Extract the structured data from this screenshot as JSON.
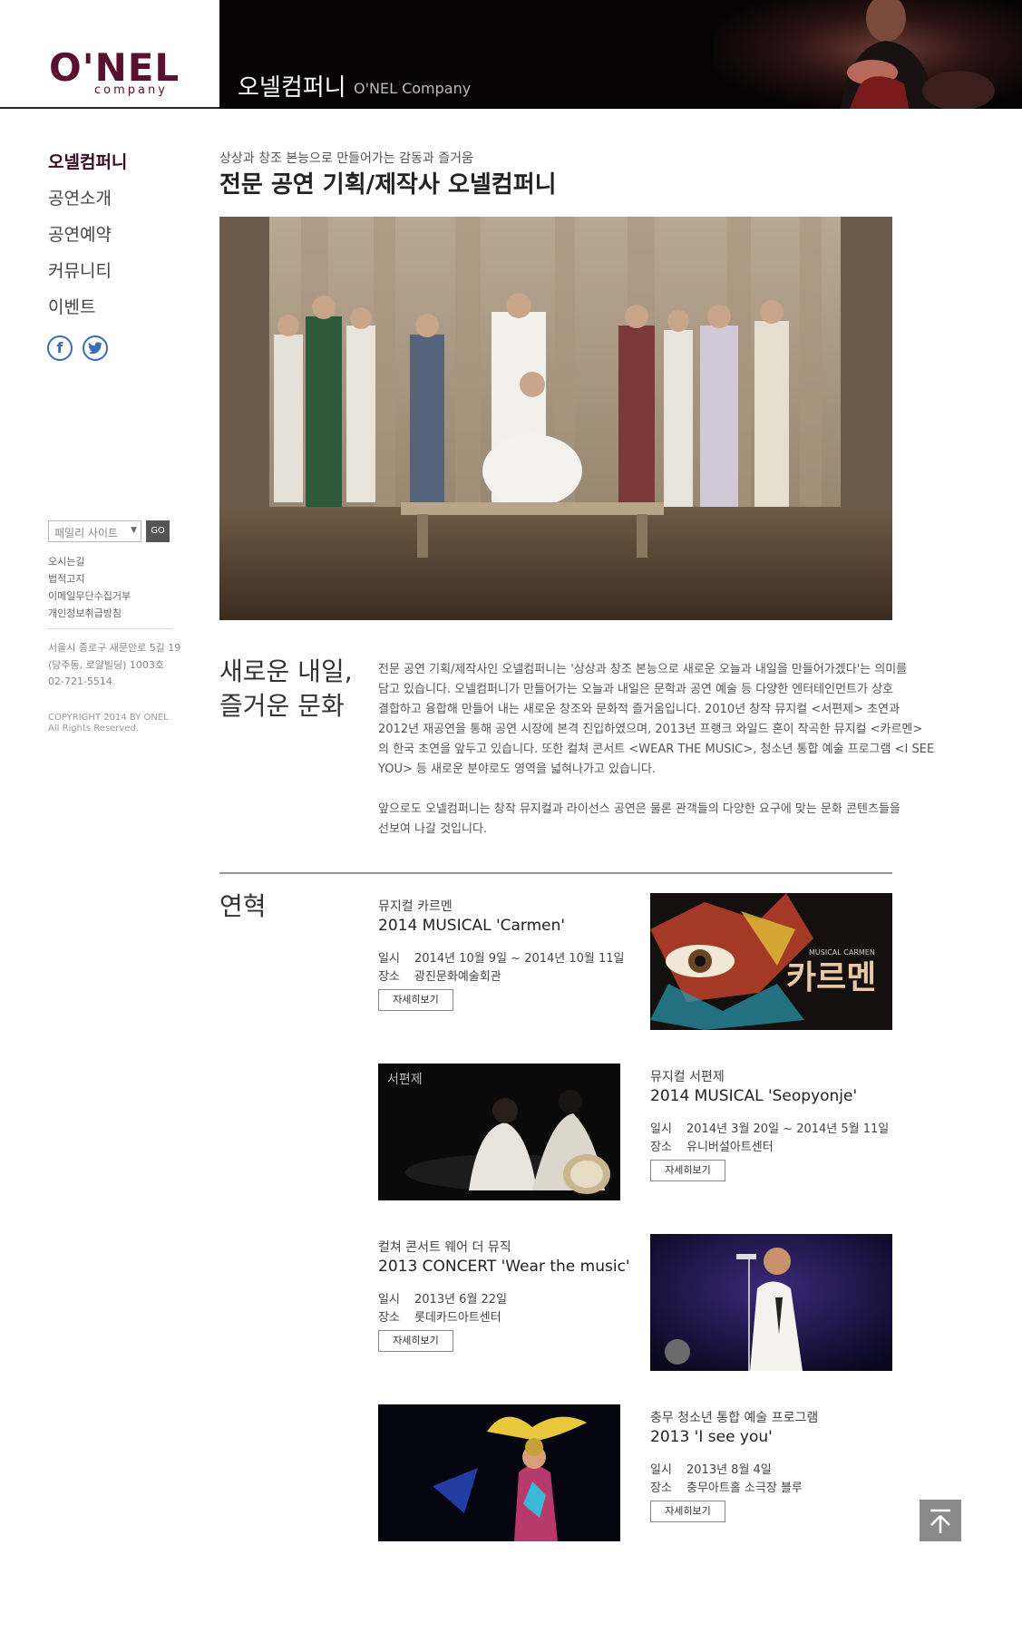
{
  "header": {
    "logo": "O'NEL",
    "logo_sub": "company",
    "title": "오넬컴퍼니",
    "subtitle": "O'NEL Company"
  },
  "sidebar": {
    "nav": [
      "오넬컴퍼니",
      "공연소개",
      "공연예약",
      "커뮤니티",
      "이벤트"
    ],
    "social": {
      "facebook": "facebook-icon",
      "twitter": "twitter-icon"
    },
    "family_site": {
      "placeholder": "패밀리 사이트",
      "go": "GO"
    },
    "links": [
      "오시는길",
      "법적고지",
      "이메일무단수집거부",
      "개인정보취급방침"
    ],
    "address": [
      "서울시 종로구 새문안로 5길 19",
      "(당주동, 로얄빌딩) 1003호",
      "02-721-5514"
    ],
    "copyright": [
      "COPYRIGHT 2014 BY ONEL",
      "All Rights Reserved."
    ]
  },
  "main": {
    "kicker": "상상과 창조 본능으로 만들어가는 감동과 즐거움",
    "title": "전문 공연 기획/제작사 오넬컴퍼니",
    "intro_heading": [
      "새로운 내일,",
      "즐거운 문화"
    ],
    "intro_lines": [
      "전문 공연 기획/제작사인 오넬컴퍼니는 '상상과 창조 본능으로 새로운 오늘과 내일을 만들어가겠다'는 의미를",
      "담고 있습니다. 오넬컴퍼니가 만들어가는 오늘과 내일은 문학과 공연 예술 등 다양한 엔터테인먼트가 상호",
      "결합하고 융합해 만들어 내는 새로운 창조와 문화적 즐거움입니다. 2010년 창작 뮤지컬 <서편제> 초연과",
      "2012년 재공연을 통해 공연 시장에 본격 진입하였으며, 2013년 프랭크 와일드 혼이 작곡한 뮤지컬 <카르멘>",
      "의 한국 초연을 앞두고 있습니다. 또한 컬쳐 콘서트 <WEAR THE MUSIC>, 청소년 통합 예술 프로그램 <I SEE",
      "YOU> 등 새로운 분야로도 영역을 넓혀나가고 있습니다.",
      "앞으로도 오넬컴퍼니는 창작 뮤지컬과 라이선스 공연은 물론 관객들의 다양한 요구에 맞는 문화 콘텐츠들을",
      "선보여 나갈 것입니다."
    ],
    "history_heading": "연혁",
    "history": [
      {
        "kicker": "뮤지컬 카르멘",
        "title": "2014  MUSICAL 'Carmen'",
        "date_label": "일시",
        "date": "2014년 10월 9일 ~ 2014년 10월 11일",
        "place_label": "장소",
        "place": "광진문화예술회관",
        "button": "자세히보기",
        "image_text": "카르멘",
        "image_caption": "MUSICAL CARMEN"
      },
      {
        "kicker": "뮤지컬 서편제",
        "title": "2014  MUSICAL 'Seopyonje'",
        "date_label": "일시",
        "date": "2014년 3월 20일 ~ 2014년 5월 11일",
        "place_label": "장소",
        "place": "유니버설아트센터",
        "button": "자세히보기",
        "image_text": "서편제"
      },
      {
        "kicker": "컬쳐 콘서트 웨어 더 뮤직",
        "title": "2013  CONCERT 'Wear the music'",
        "date_label": "일시",
        "date": "2013년 6월 22일",
        "place_label": "장소",
        "place": "롯데카드아트센터",
        "button": "자세히보기"
      },
      {
        "kicker": "충무 청소년 통합 예술 프로그램",
        "title": "2013  'I see you'",
        "date_label": "일시",
        "date": "2013년 8월 4일",
        "place_label": "장소",
        "place": "충무아트홀 소극장 블루",
        "button": "자세히보기"
      }
    ]
  },
  "colors": {
    "brand": "#5a1030",
    "accent": "#3b6db4",
    "header_bg": "#050304"
  }
}
